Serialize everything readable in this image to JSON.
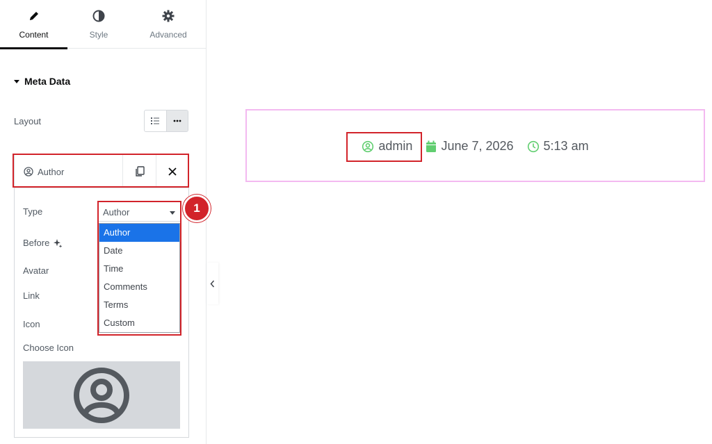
{
  "tabs": [
    {
      "label": "Content",
      "icon": "pencil-icon"
    },
    {
      "label": "Style",
      "icon": "contrast-icon"
    },
    {
      "label": "Advanced",
      "icon": "gear-icon"
    }
  ],
  "section": {
    "title": "Meta Data"
  },
  "layout": {
    "label": "Layout",
    "options": [
      "list",
      "inline"
    ],
    "selected": "inline"
  },
  "repeater": {
    "item_label": "Author",
    "fields": {
      "type": "Type",
      "before": "Before",
      "avatar": "Avatar",
      "link": "Link",
      "icon": "Icon",
      "choose_icon": "Choose Icon"
    },
    "select": {
      "value": "Author",
      "options": [
        "Author",
        "Date",
        "Time",
        "Comments",
        "Terms",
        "Custom"
      ]
    },
    "icon_preview": "user-circle-icon"
  },
  "badge": "1",
  "preview": {
    "author": "admin",
    "date": "June 7, 2026",
    "time": "5:13 am"
  },
  "colors": {
    "highlight": "#d2232a",
    "dropdown_selected": "#1a73e8",
    "meta_icon": "#61ce70",
    "preview_border": "#f3b9f0"
  }
}
